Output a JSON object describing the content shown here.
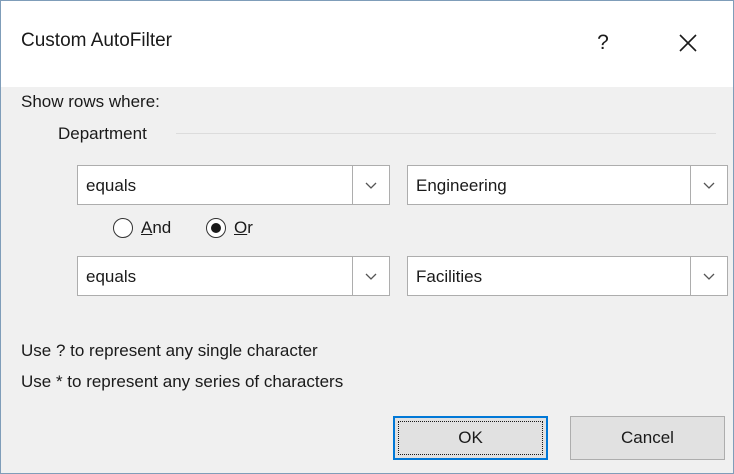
{
  "window": {
    "title": "Custom AutoFilter",
    "help_glyph": "?"
  },
  "show_rows_label": "Show rows where:",
  "group_label": "Department",
  "condition1": {
    "operator": "equals",
    "value": "Engineering"
  },
  "logic": {
    "and_label": "And",
    "and_mnemonic": "A",
    "and_rest": "nd",
    "or_label": "Or",
    "or_mnemonic": "O",
    "or_rest": "r",
    "selected": "Or"
  },
  "condition2": {
    "operator": "equals",
    "value": "Facilities"
  },
  "hints": [
    "Use ? to represent any single character",
    "Use * to represent any series of characters"
  ],
  "buttons": {
    "ok_label": "OK",
    "cancel_label": "Cancel"
  },
  "colors": {
    "default_button_border": "#0078d7",
    "dialog_background": "#f0f0f0"
  },
  "icons": {
    "close": "close-icon",
    "dropdown": "chevron-down-icon"
  }
}
